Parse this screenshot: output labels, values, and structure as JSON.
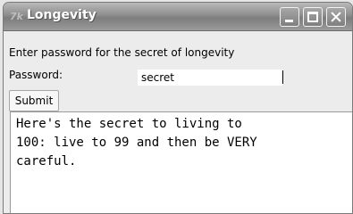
{
  "window": {
    "title": "Longevity",
    "app_icon_text": "7k"
  },
  "form": {
    "prompt": "Enter password for the secret of longevity",
    "password_label": "Password:",
    "password_value": "secret",
    "submit_label": "Submit"
  },
  "output": {
    "text": "Here's the secret to living to\n100: live to 99 and then be VERY\ncareful."
  }
}
